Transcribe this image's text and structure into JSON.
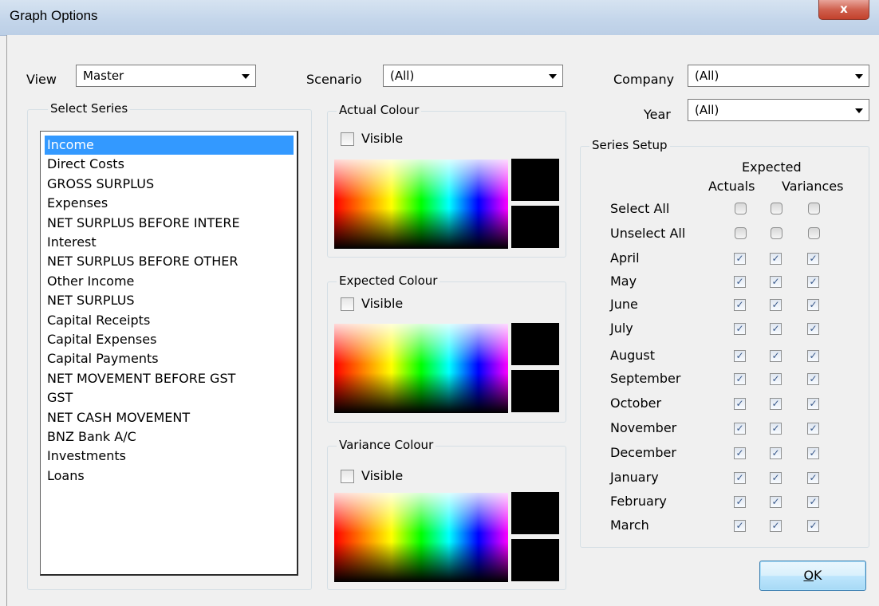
{
  "window": {
    "title": "Graph Options",
    "close_glyph": "x"
  },
  "filters": {
    "view": {
      "label": "View",
      "value": "Master"
    },
    "scenario": {
      "label": "Scenario",
      "value": "(All)"
    },
    "company": {
      "label": "Company",
      "value": "(All)"
    },
    "year": {
      "label": "Year",
      "value": "(All)"
    }
  },
  "select_series": {
    "title": "Select Series",
    "selected_index": 0,
    "items": [
      "Income",
      "Direct Costs",
      "GROSS SURPLUS",
      "Expenses",
      "NET SURPLUS BEFORE INTERE",
      "Interest",
      "NET SURPLUS BEFORE OTHER",
      "Other Income",
      "NET SURPLUS",
      "Capital Receipts",
      "Capital Expenses",
      "Capital Payments",
      "NET MOVEMENT BEFORE GST",
      "GST",
      "NET CASH MOVEMENT",
      "BNZ Bank A/C",
      "Investments",
      "Loans"
    ]
  },
  "colours": {
    "actual": {
      "title": "Actual Colour",
      "visible_label": "Visible",
      "visible": false
    },
    "expected": {
      "title": "Expected Colour",
      "visible_label": "Visible",
      "visible": false
    },
    "variance": {
      "title": "Variance Colour",
      "visible_label": "Visible",
      "visible": false
    },
    "swatch_color": "#000000"
  },
  "series_setup": {
    "title": "Series Setup",
    "headers": {
      "expected": "Expected",
      "actuals": "Actuals",
      "variances": "Variances"
    },
    "select_all": "Select All",
    "unselect_all": "Unselect All",
    "months": [
      "April",
      "May",
      "June",
      "July",
      "August",
      "September",
      "October",
      "November",
      "December",
      "January",
      "February",
      "March"
    ],
    "check_glyph": "✓"
  },
  "buttons": {
    "ok_mnemonic": "O",
    "ok_rest": "K"
  }
}
